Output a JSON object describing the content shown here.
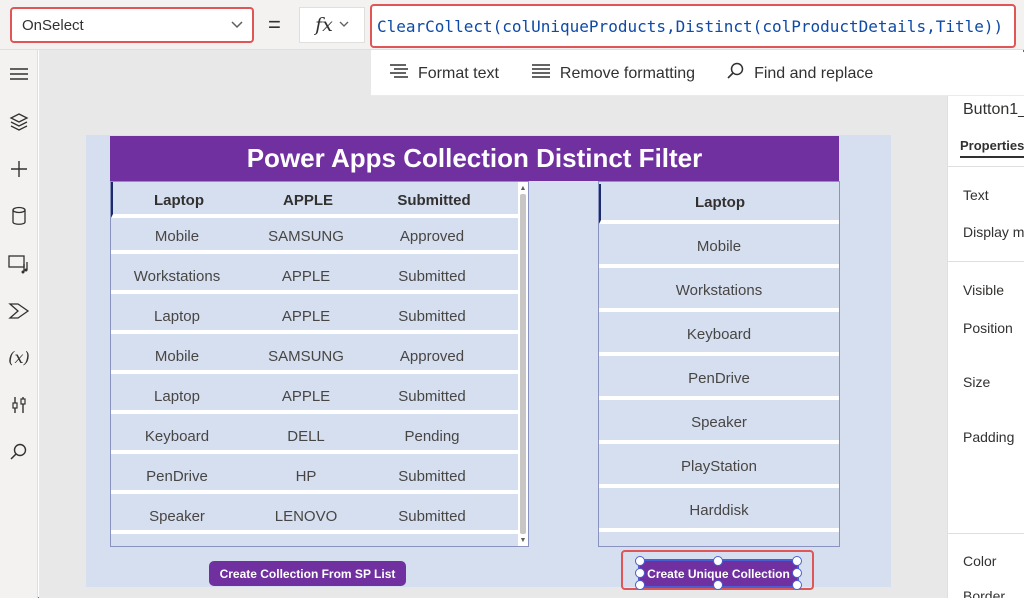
{
  "formula_bar": {
    "property": "OnSelect",
    "equals": "=",
    "fx": "fx",
    "formula": "ClearCollect(colUniqueProducts,Distinct(colProductDetails,Title))"
  },
  "left_rail": {
    "icons": [
      "hamburger-icon",
      "layers-icon",
      "plus-icon",
      "database-icon",
      "media-icon",
      "power-automate-icon",
      "variables-icon",
      "tools-icon",
      "search-icon"
    ],
    "variables_glyph": "(x)"
  },
  "format_toolbar": {
    "format_text": "Format text",
    "remove_formatting": "Remove formatting",
    "find_replace": "Find and replace"
  },
  "app": {
    "title": "Power Apps Collection Distinct Filter",
    "left_gallery": {
      "rows": [
        [
          "Laptop",
          "APPLE",
          "Submitted"
        ],
        [
          "Mobile",
          "SAMSUNG",
          "Approved"
        ],
        [
          "Workstations",
          "APPLE",
          "Submitted"
        ],
        [
          "Laptop",
          "APPLE",
          "Submitted"
        ],
        [
          "Mobile",
          "SAMSUNG",
          "Approved"
        ],
        [
          "Laptop",
          "APPLE",
          "Submitted"
        ],
        [
          "Keyboard",
          "DELL",
          "Pending"
        ],
        [
          "PenDrive",
          "HP",
          "Submitted"
        ],
        [
          "Speaker",
          "LENOVO",
          "Submitted"
        ]
      ]
    },
    "right_gallery": {
      "rows": [
        "Laptop",
        "Mobile",
        "Workstations",
        "Keyboard",
        "PenDrive",
        "Speaker",
        "PlayStation",
        "Harddisk"
      ]
    },
    "button_left": "Create Collection From SP List",
    "button_right": "Create Unique Collection"
  },
  "properties_panel": {
    "control_name": "Button1_",
    "tab": "Properties",
    "labels": [
      "Text",
      "Display m",
      "Visible",
      "Position",
      "Size",
      "Padding",
      "Color",
      "Border"
    ]
  },
  "colors": {
    "accent_purple": "#7030a0",
    "highlight_red": "#e05555",
    "formula_blue": "#0e4aa6",
    "gallery_bg": "#d6dff0"
  }
}
